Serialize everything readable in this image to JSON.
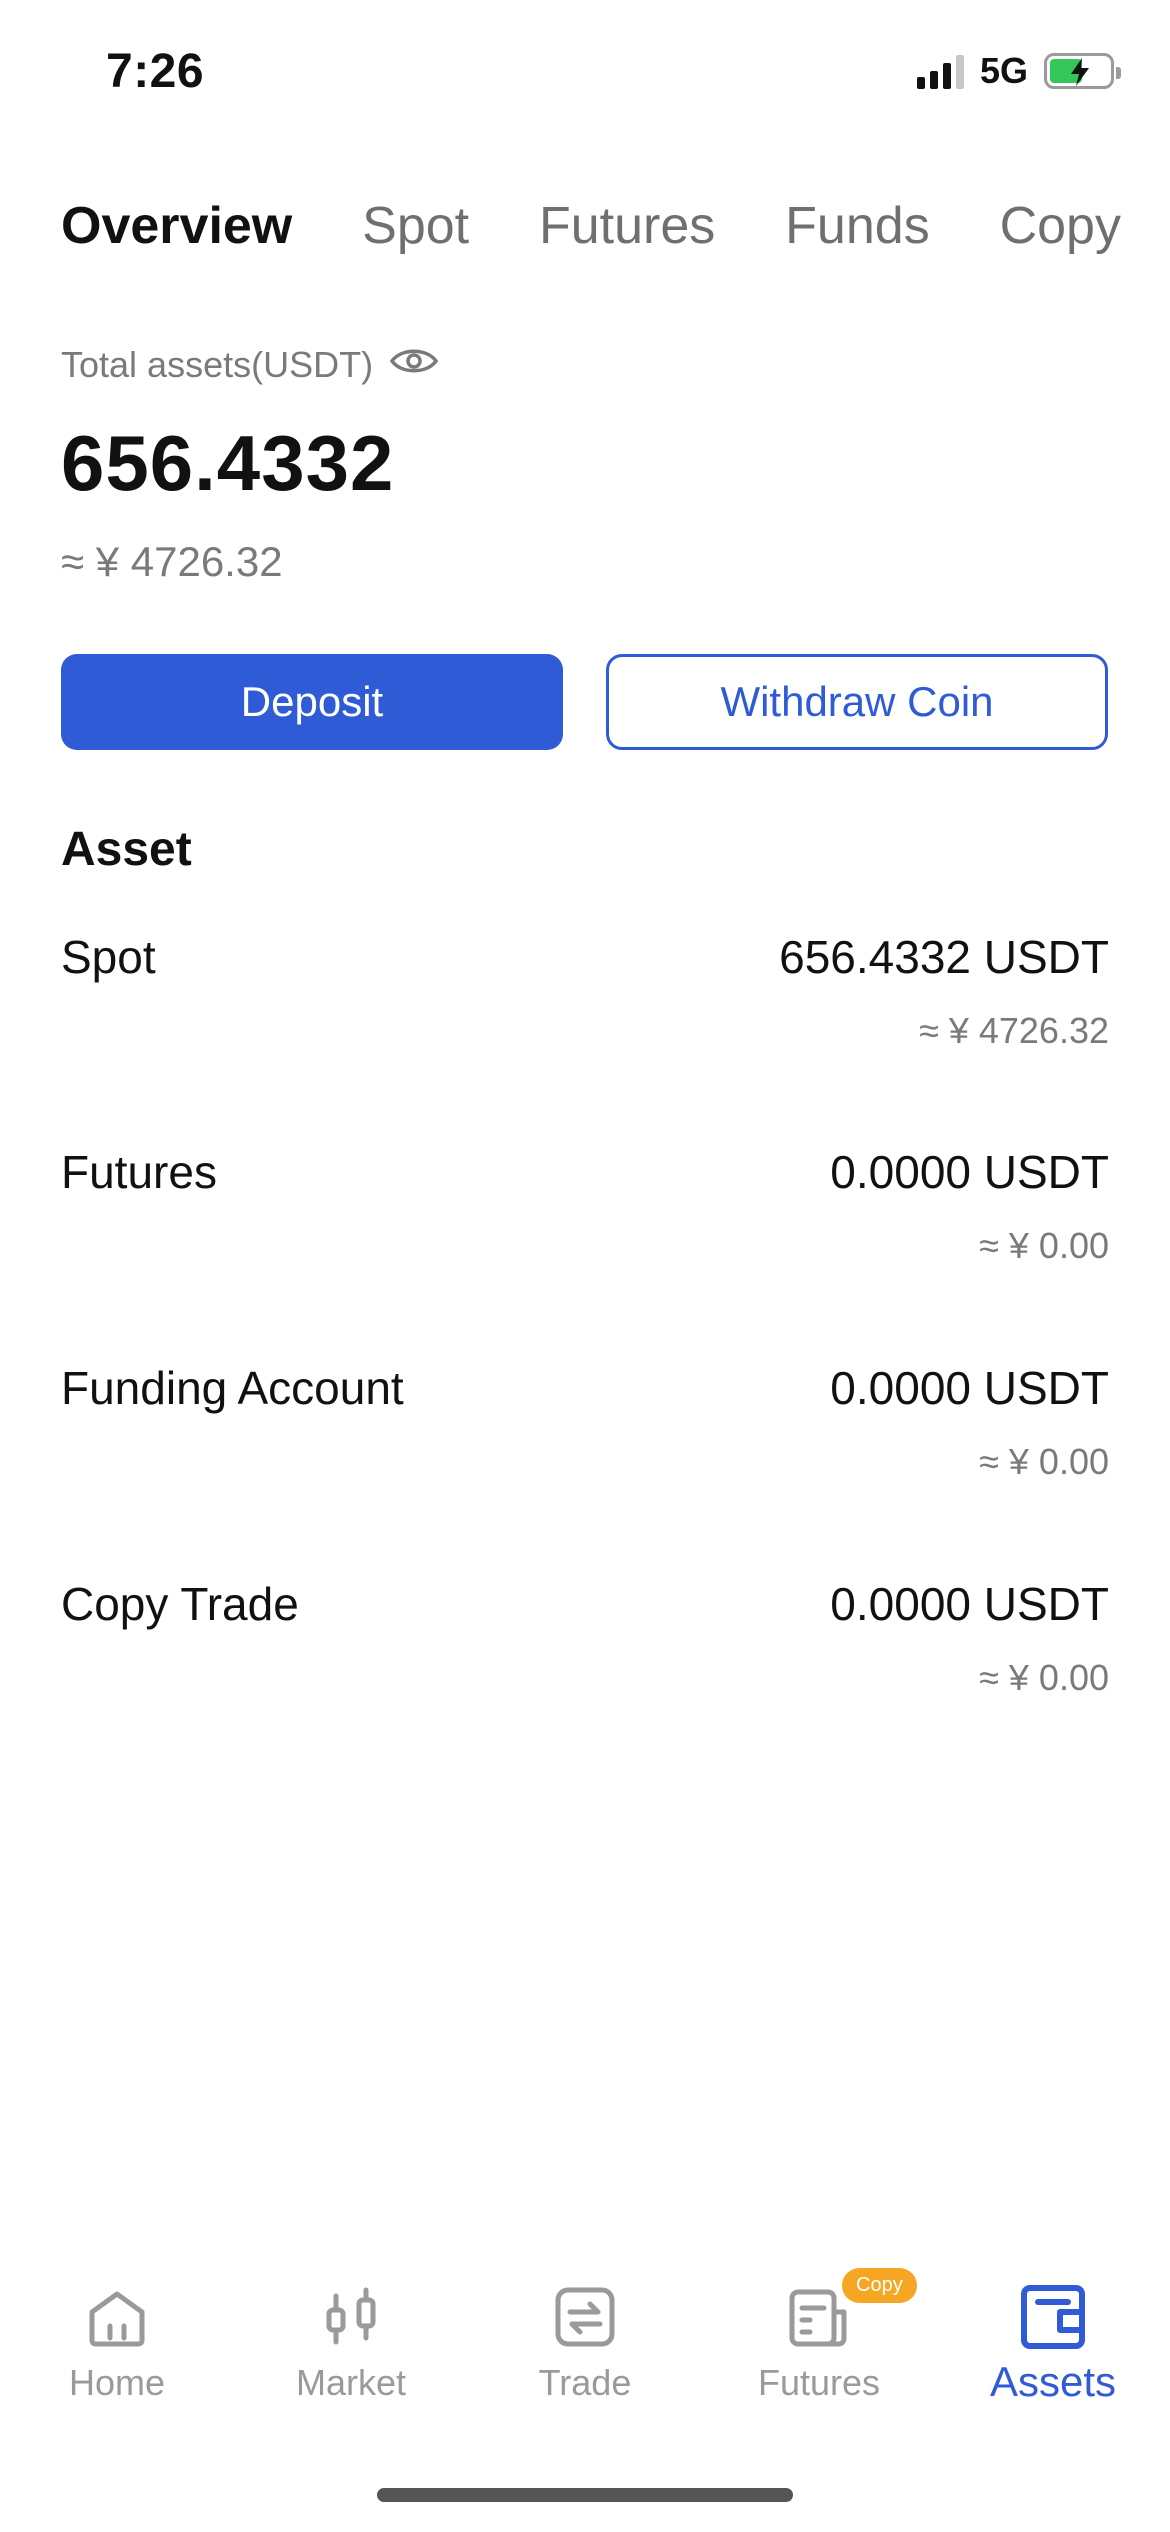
{
  "status_bar": {
    "time": "7:26",
    "network": "5G"
  },
  "tabs": [
    {
      "label": "Overview",
      "active": true
    },
    {
      "label": "Spot",
      "active": false
    },
    {
      "label": "Futures",
      "active": false
    },
    {
      "label": "Funds",
      "active": false
    },
    {
      "label": "Copy",
      "active": false
    }
  ],
  "summary": {
    "label": "Total assets(USDT)",
    "value": "656.4332",
    "cny": "≈ ¥ 4726.32",
    "visibility_icon": "eye-icon"
  },
  "actions": {
    "deposit": "Deposit",
    "withdraw": "Withdraw Coin"
  },
  "asset_section": {
    "title": "Asset",
    "items": [
      {
        "name": "Spot",
        "amount": "656.4332 USDT",
        "cny": "≈ ¥ 4726.32"
      },
      {
        "name": "Futures",
        "amount": "0.0000 USDT",
        "cny": "≈ ¥ 0.00"
      },
      {
        "name": "Funding Account",
        "amount": "0.0000 USDT",
        "cny": "≈ ¥ 0.00"
      },
      {
        "name": "Copy Trade",
        "amount": "0.0000 USDT",
        "cny": "≈ ¥ 0.00"
      }
    ]
  },
  "bottom_nav": {
    "items": [
      {
        "label": "Home",
        "icon": "home-icon"
      },
      {
        "label": "Market",
        "icon": "candlestick-icon"
      },
      {
        "label": "Trade",
        "icon": "trade-icon"
      },
      {
        "label": "Futures",
        "icon": "document-icon",
        "badge": "Copy"
      },
      {
        "label": "Assets",
        "icon": "wallet-icon",
        "active": true
      }
    ]
  },
  "colors": {
    "accent": "#2f5bd6",
    "badge": "#f5a623",
    "muted": "#7a7a7a"
  }
}
